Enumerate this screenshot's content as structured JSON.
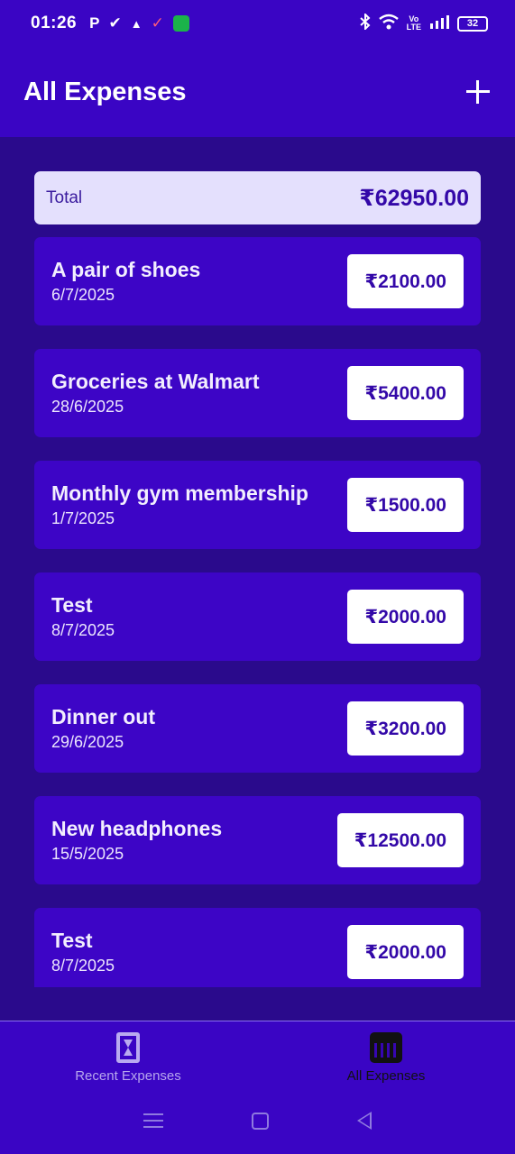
{
  "status_bar": {
    "time": "01:26",
    "left_icons": [
      "P",
      "✔",
      "▲",
      "✓",
      "shield-icon"
    ],
    "right_icons": [
      "bluetooth-icon",
      "wifi-icon",
      "volte-icon",
      "signal-icon"
    ],
    "battery": "32"
  },
  "app_bar": {
    "title": "All Expenses",
    "add_icon": "plus-icon"
  },
  "total": {
    "label": "Total",
    "value": "₹62950.00"
  },
  "expenses": [
    {
      "title": "A pair of shoes",
      "date": "6/7/2025",
      "amount": "₹2100.00"
    },
    {
      "title": "Groceries at Walmart",
      "date": "28/6/2025",
      "amount": "₹5400.00"
    },
    {
      "title": "Monthly gym membership",
      "date": "1/7/2025",
      "amount": "₹1500.00"
    },
    {
      "title": "Test",
      "date": "8/7/2025",
      "amount": "₹2000.00"
    },
    {
      "title": "Dinner out",
      "date": "29/6/2025",
      "amount": "₹3200.00"
    },
    {
      "title": "New headphones",
      "date": "15/5/2025",
      "amount": "₹12500.00"
    },
    {
      "title": "Test",
      "date": "8/7/2025",
      "amount": "₹2000.00"
    }
  ],
  "bottom_nav": {
    "recent": {
      "label": "Recent Expenses",
      "icon": "hourglass-icon"
    },
    "all": {
      "label": "All Expenses",
      "icon": "calendar-icon"
    }
  },
  "colors": {
    "primary": "#3a05c4",
    "background": "#2a0a8c",
    "card": "#3d05c6",
    "total_card": "#e4e0fd",
    "amount_text": "#3308a8"
  }
}
